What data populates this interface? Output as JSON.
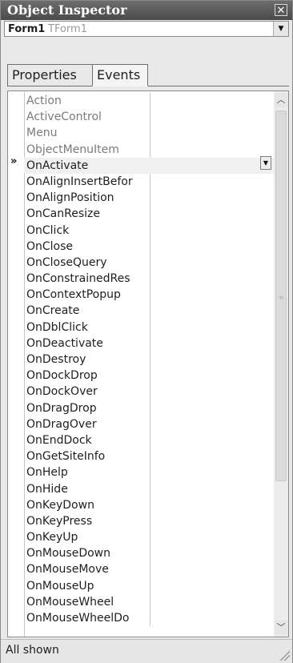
{
  "window": {
    "title": "Object Inspector",
    "close_glyph": "✕"
  },
  "object_selector": {
    "name": "Form1",
    "type": "TForm1",
    "icon": "chevron-down-icon"
  },
  "tabs": [
    {
      "label": "Properties",
      "active": false
    },
    {
      "label": "Events",
      "active": true
    }
  ],
  "grid": {
    "selected_marker": "»",
    "selected_index": 4,
    "rows": [
      {
        "name": "Action",
        "kind": "inherited"
      },
      {
        "name": "ActiveControl",
        "kind": "inherited"
      },
      {
        "name": "Menu",
        "kind": "inherited"
      },
      {
        "name": "ObjectMenuItem",
        "kind": "inherited"
      },
      {
        "name": "OnActivate",
        "kind": "event"
      },
      {
        "name": "OnAlignInsertBefor",
        "kind": "event"
      },
      {
        "name": "OnAlignPosition",
        "kind": "event"
      },
      {
        "name": "OnCanResize",
        "kind": "event"
      },
      {
        "name": "OnClick",
        "kind": "event"
      },
      {
        "name": "OnClose",
        "kind": "event"
      },
      {
        "name": "OnCloseQuery",
        "kind": "event"
      },
      {
        "name": "OnConstrainedRes",
        "kind": "event"
      },
      {
        "name": "OnContextPopup",
        "kind": "event"
      },
      {
        "name": "OnCreate",
        "kind": "event"
      },
      {
        "name": "OnDblClick",
        "kind": "event"
      },
      {
        "name": "OnDeactivate",
        "kind": "event"
      },
      {
        "name": "OnDestroy",
        "kind": "event"
      },
      {
        "name": "OnDockDrop",
        "kind": "event"
      },
      {
        "name": "OnDockOver",
        "kind": "event"
      },
      {
        "name": "OnDragDrop",
        "kind": "event"
      },
      {
        "name": "OnDragOver",
        "kind": "event"
      },
      {
        "name": "OnEndDock",
        "kind": "event"
      },
      {
        "name": "OnGetSiteInfo",
        "kind": "event"
      },
      {
        "name": "OnHelp",
        "kind": "event"
      },
      {
        "name": "OnHide",
        "kind": "event"
      },
      {
        "name": "OnKeyDown",
        "kind": "event"
      },
      {
        "name": "OnKeyPress",
        "kind": "event"
      },
      {
        "name": "OnKeyUp",
        "kind": "event"
      },
      {
        "name": "OnMouseDown",
        "kind": "event"
      },
      {
        "name": "OnMouseMove",
        "kind": "event"
      },
      {
        "name": "OnMouseUp",
        "kind": "event"
      },
      {
        "name": "OnMouseWheel",
        "kind": "event"
      },
      {
        "name": "OnMouseWheelDo",
        "kind": "event"
      }
    ]
  },
  "status": {
    "text": "All shown"
  },
  "colors": {
    "titlebar": "#555555",
    "inherited_text": "#7a7a7a",
    "event_text": "#1e1e1e"
  }
}
